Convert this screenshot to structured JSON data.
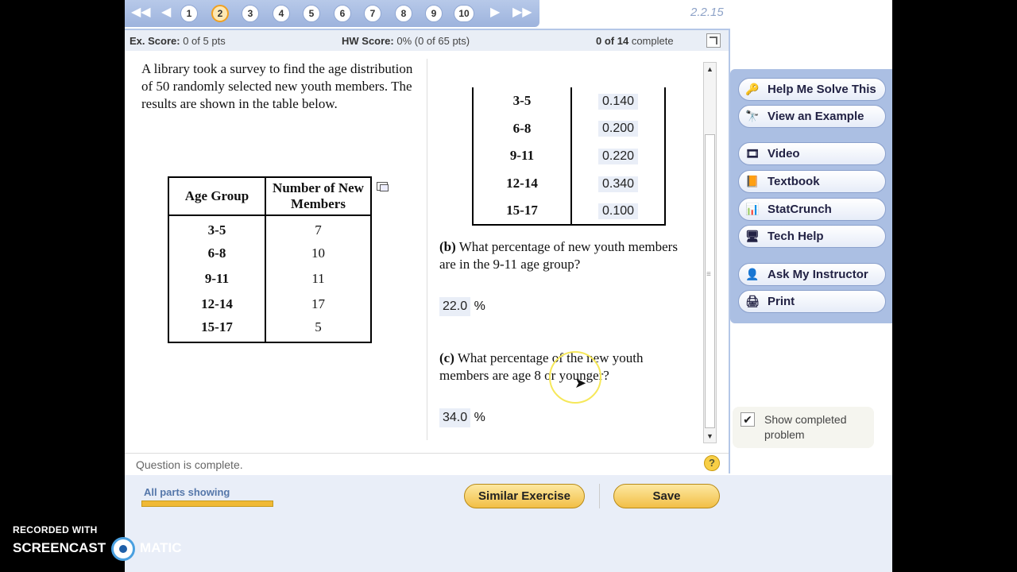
{
  "nav": {
    "pages": [
      "1",
      "2",
      "3",
      "4",
      "5",
      "6",
      "7",
      "8",
      "9",
      "10"
    ],
    "current_page": "2",
    "version": "2.2.15"
  },
  "score": {
    "ex_label": "Ex. Score:",
    "ex_value": "0 of 5 pts",
    "hw_label": "HW Score:",
    "hw_value": "0% (0 of 65 pts)",
    "complete_count": "0 of 14",
    "complete_label": "complete"
  },
  "problem": {
    "intro": "A library took a survey to find the age distribution of 50 randomly selected new youth members. The results are shown in the table below.",
    "table_headers": [
      "Age Group",
      "Number of New Members"
    ],
    "rows": [
      {
        "group": "3-5",
        "members": "7"
      },
      {
        "group": "6-8",
        "members": "10"
      },
      {
        "group": "9-11",
        "members": "11"
      },
      {
        "group": "12-14",
        "members": "17"
      },
      {
        "group": "15-17",
        "members": "5"
      }
    ],
    "rel_rows": [
      {
        "group": "3-5",
        "value": "0.140"
      },
      {
        "group": "6-8",
        "value": "0.200"
      },
      {
        "group": "9-11",
        "value": "0.220"
      },
      {
        "group": "12-14",
        "value": "0.340"
      },
      {
        "group": "15-17",
        "value": "0.100"
      }
    ],
    "part_b": {
      "letter": "(b)",
      "text": "What percentage of new youth members are in the 9-11 age group?",
      "answer": "22.0",
      "unit": "%"
    },
    "part_c": {
      "letter": "(c)",
      "text": "What percentage of the new youth members are age 8 or younger?",
      "answer": "34.0",
      "unit": "%"
    }
  },
  "status": {
    "text": "Question is complete.",
    "help": "?"
  },
  "bottom": {
    "parts_label": "All parts showing",
    "progress_fraction": 1.0,
    "similar_button": "Similar Exercise",
    "save_button": "Save"
  },
  "side": {
    "buttons": [
      {
        "label": "Help Me Solve This",
        "icon": "key-icon"
      },
      {
        "label": "View an Example",
        "icon": "binoculars-icon"
      },
      {
        "label": "Video",
        "icon": "film-icon"
      },
      {
        "label": "Textbook",
        "icon": "book-icon"
      },
      {
        "label": "StatCrunch",
        "icon": "chart-icon"
      },
      {
        "label": "Tech Help",
        "icon": "monitor-icon"
      },
      {
        "label": "Ask My Instructor",
        "icon": "person-icon"
      },
      {
        "label": "Print",
        "icon": "printer-icon"
      }
    ],
    "show_completed": "Show completed problem"
  },
  "watermark": {
    "line1": "RECORDED WITH",
    "line2": "SCREENCAST",
    "line3": "MATIC"
  },
  "colors": {
    "accent": "#f2bf46",
    "panel": "#abbfe3",
    "nav": "#9db3dd"
  }
}
